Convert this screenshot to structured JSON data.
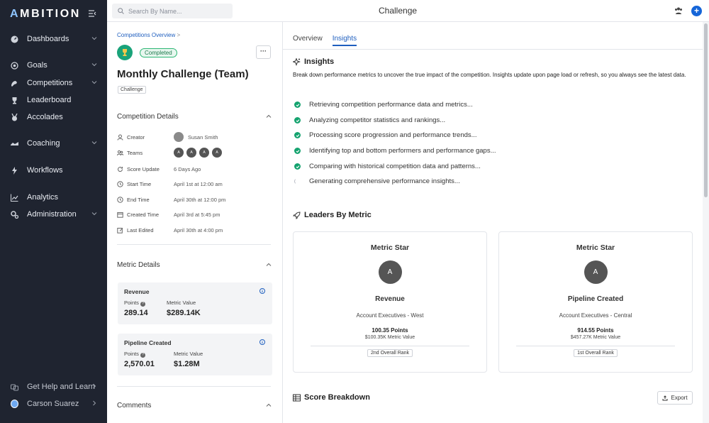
{
  "app": {
    "logo_a": "A",
    "logo_rest": "MBITION"
  },
  "sidebar": {
    "items": [
      {
        "label": "Dashboards",
        "icon": "dashboard-icon",
        "chevron": true
      },
      {
        "label": "Goals",
        "icon": "target-icon",
        "chevron": true
      },
      {
        "label": "Competitions",
        "icon": "competitions-icon",
        "chevron": true
      },
      {
        "label": "Leaderboard",
        "icon": "trophy-icon",
        "chevron": false
      },
      {
        "label": "Accolades",
        "icon": "medal-icon",
        "chevron": false
      },
      {
        "label": "Coaching",
        "icon": "coaching-icon",
        "chevron": true
      },
      {
        "label": "Workflows",
        "icon": "bolt-icon",
        "chevron": false
      },
      {
        "label": "Analytics",
        "icon": "chart-icon",
        "chevron": false
      },
      {
        "label": "Administration",
        "icon": "settings-icon",
        "chevron": true
      }
    ],
    "help": "Get Help and Learn",
    "user": "Carson Suarez"
  },
  "topbar": {
    "search_placeholder": "Search By Name...",
    "title": "Challenge"
  },
  "competition": {
    "breadcrumb": "Competitions Overview",
    "breadcrumb_sep": ">",
    "status": "Completed",
    "more": "···",
    "title": "Monthly Challenge (Team)",
    "tag": "Challenge",
    "details_header": "Competition Details",
    "details": [
      {
        "label": "Creator",
        "value": "Susan Smith",
        "icon": "user-icon"
      },
      {
        "label": "Teams",
        "value": "",
        "icon": "teams-icon"
      },
      {
        "label": "Score Update",
        "value": "6 Days Ago",
        "icon": "refresh-icon"
      },
      {
        "label": "Start Time",
        "value": "April 1st at 12:00 am",
        "icon": "clock-icon"
      },
      {
        "label": "End Time",
        "value": "April 30th at 12:00 pm",
        "icon": "clock-icon"
      },
      {
        "label": "Created Time",
        "value": "April 3rd at 5:45 pm",
        "icon": "calendar-icon"
      },
      {
        "label": "Last Edited",
        "value": "April 30th at 4:00 pm",
        "icon": "edit-icon"
      }
    ],
    "team_avatars": [
      "A",
      "A",
      "A",
      "A"
    ],
    "metric_header": "Metric Details",
    "metrics": [
      {
        "name": "Revenue",
        "points_label": "Points",
        "value_label": "Metric Value",
        "points": "289.14",
        "value": "$289.14K"
      },
      {
        "name": "Pipeline Created",
        "points_label": "Points",
        "value_label": "Metric Value",
        "points": "2,570.01",
        "value": "$1.28M"
      }
    ],
    "comments_header": "Comments"
  },
  "right": {
    "tabs": [
      "Overview",
      "Insights"
    ],
    "insights_title": "Insights",
    "insights_desc": "Break down performance metrics to uncover the true impact of the competition. Insights update upon page load or refresh, so you always see the latest data.",
    "steps": [
      {
        "text": "Retrieving competition performance data and metrics...",
        "done": true
      },
      {
        "text": "Analyzing competitor statistics and rankings...",
        "done": true
      },
      {
        "text": "Processing score progression and performance trends...",
        "done": true
      },
      {
        "text": "Identifying top and bottom performers and performance gaps...",
        "done": true
      },
      {
        "text": "Comparing with historical competition data and patterns...",
        "done": true
      },
      {
        "text": "Generating comprehensive performance insights...",
        "done": false
      }
    ],
    "leaders_title": "Leaders By Metric",
    "leaders": [
      {
        "title": "Metric Star",
        "avatar": "A",
        "metric": "Revenue",
        "team": "Account Executives - West",
        "points": "100.35 Points",
        "metric_value": "$100.35K Metric Value",
        "rank": "2nd Overall Rank"
      },
      {
        "title": "Metric Star",
        "avatar": "A",
        "metric": "Pipeline Created",
        "team": "Account Executives - Central",
        "points": "914.55 Points",
        "metric_value": "$457.27K Metric Value",
        "rank": "1st Overall Rank"
      }
    ],
    "score_title": "Score Breakdown",
    "export": "Export"
  },
  "colors": {
    "sidebar_bg": "#1f2430",
    "accent": "#1f5fbf",
    "success": "#15a36f"
  }
}
